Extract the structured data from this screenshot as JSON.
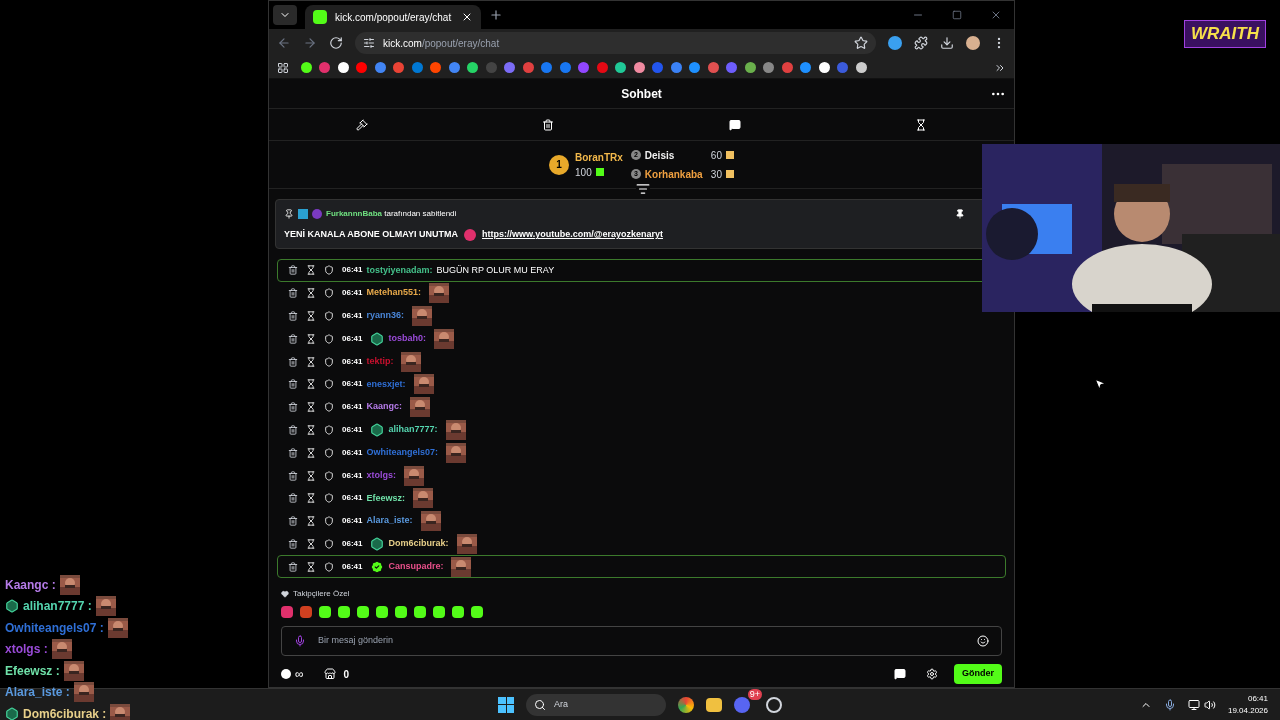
{
  "overlay_logo": {
    "text": "WRAITH"
  },
  "browser": {
    "tab_title": "kick.com/popout/eray/chat",
    "url_host": "kick.com",
    "url_path": "/popout/eray/chat"
  },
  "chat": {
    "title": "Sohbet",
    "leaderboard": [
      {
        "rank": "1",
        "user": "BoranTRx",
        "amount": "100",
        "color": "#f2b84b"
      },
      {
        "rank": "2",
        "user": "Deisis",
        "amount": "60",
        "color": "#f0f0f0"
      },
      {
        "rank": "3",
        "user": "Korhankaba",
        "amount": "30",
        "color": "#f0a040"
      }
    ],
    "pinned": {
      "user": "FurkannnBaba",
      "suffix": "tarafından sabitlendi",
      "message": "YENİ KANALA ABONE OLMAYI UNUTMA",
      "link": "https://www.youtube.com/@erayozkenaryt"
    },
    "messages": [
      {
        "kind": "text",
        "time": "06:41",
        "user": "tostyiyenadam:",
        "color": "#44c08a",
        "message": "BUGÜN RP OLUR MU ERAY",
        "subscriber": false,
        "verified": false,
        "highlighted": true
      },
      {
        "kind": "emote",
        "time": "06:41",
        "user": "Metehan551:",
        "color": "#e8a94a",
        "subscriber": false,
        "verified": false,
        "highlighted": false
      },
      {
        "kind": "emote",
        "time": "06:41",
        "user": "ryann36:",
        "color": "#4a86d8",
        "subscriber": false,
        "verified": false,
        "highlighted": false
      },
      {
        "kind": "emote",
        "time": "06:41",
        "user": "tosbah0:",
        "color": "#9a4bd8",
        "subscriber": true,
        "verified": false,
        "highlighted": false
      },
      {
        "kind": "emote",
        "time": "06:41",
        "user": "tektip:",
        "color": "#c8102e",
        "subscriber": false,
        "verified": false,
        "highlighted": false
      },
      {
        "kind": "emote",
        "time": "06:41",
        "user": "enesxjet:",
        "color": "#2f6fd6",
        "subscriber": false,
        "verified": false,
        "highlighted": false
      },
      {
        "kind": "emote",
        "time": "06:41",
        "user": "Kaangc:",
        "color": "#b57be8",
        "subscriber": false,
        "verified": false,
        "highlighted": false
      },
      {
        "kind": "emote",
        "time": "06:41",
        "user": "alihan7777:",
        "color": "#55d6b0",
        "subscriber": true,
        "verified": false,
        "highlighted": false
      },
      {
        "kind": "emote",
        "time": "06:41",
        "user": "Owhiteangels07:",
        "color": "#2f6fd6",
        "subscriber": false,
        "verified": false,
        "highlighted": false
      },
      {
        "kind": "emote",
        "time": "06:41",
        "user": "xtolgs:",
        "color": "#9a4bd8",
        "subscriber": false,
        "verified": false,
        "highlighted": false
      },
      {
        "kind": "emote",
        "time": "06:41",
        "user": "Efeewsz:",
        "color": "#6fe0a8",
        "subscriber": false,
        "verified": false,
        "highlighted": false
      },
      {
        "kind": "emote",
        "time": "06:41",
        "user": "Alara_iste:",
        "color": "#5a9ae0",
        "subscriber": false,
        "verified": false,
        "highlighted": false
      },
      {
        "kind": "emote",
        "time": "06:41",
        "user": "Dom6ciburak:",
        "color": "#e8d08a",
        "subscriber": true,
        "verified": false,
        "highlighted": false
      },
      {
        "kind": "emote",
        "time": "06:41",
        "user": "Cansupadre:",
        "color": "#e8508a",
        "subscriber": false,
        "verified": true,
        "highlighted": true
      }
    ],
    "emote_section": "Takipçilere Özel",
    "input_placeholder": "Bir mesaj gönderin",
    "points": "∞",
    "store_count": "0",
    "send": "Gönder"
  },
  "stream_overlay": [
    {
      "user": "Kaangc :",
      "color": "#b57be8",
      "subscriber": false
    },
    {
      "user": "alihan7777 :",
      "color": "#55d6b0",
      "subscriber": true
    },
    {
      "user": "Owhiteangels07 :",
      "color": "#2f6fd6",
      "subscriber": false
    },
    {
      "user": "xtolgs :",
      "color": "#9a4bd8",
      "subscriber": false
    },
    {
      "user": "Efeewsz :",
      "color": "#6fe0a8",
      "subscriber": false
    },
    {
      "user": "Alara_iste :",
      "color": "#5a9ae0",
      "subscriber": false
    },
    {
      "user": "Dom6ciburak :",
      "color": "#e8d08a",
      "subscriber": true
    }
  ],
  "taskbar": {
    "search": "Ara",
    "discord_badge": "9+",
    "time": "06:41",
    "date": "19.04.2026"
  }
}
